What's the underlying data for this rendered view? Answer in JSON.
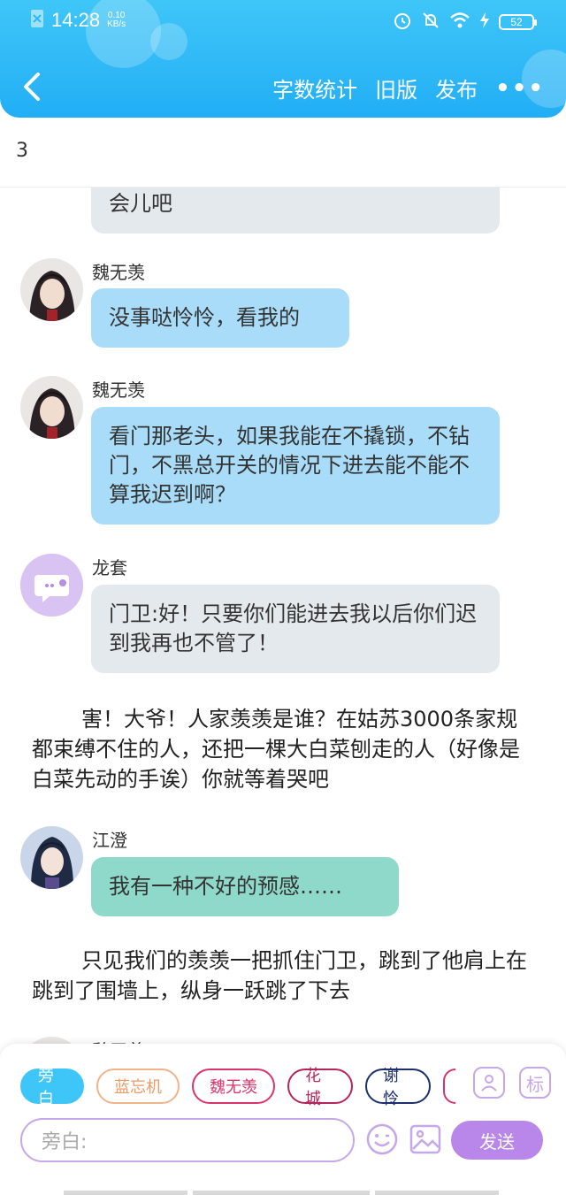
{
  "status_bar": {
    "time": "14:28",
    "net_speed_value": "0.10",
    "net_speed_unit": "KB/s",
    "battery": "52"
  },
  "nav": {
    "word_count": "字数统计",
    "old_version": "旧版",
    "publish": "发布",
    "more": "•••"
  },
  "chapter": "3",
  "messages": {
    "m0": {
      "text": "会儿吧"
    },
    "m1": {
      "name": "魏无羡",
      "text": "没事哒怜怜，看我的"
    },
    "m2": {
      "name": "魏无羡",
      "text": "看门那老头，如果我能在不撬锁，不钻门，不黑总开关的情况下进去能不能不算我迟到啊？"
    },
    "m3": {
      "name": "龙套",
      "text": "门卫:好！只要你们能进去我以后你们迟到我再也不管了！"
    },
    "n1": {
      "text": "害！大爷！人家羡羡是谁？在姑苏3000条家规都束缚不住的人，还把一棵大白菜刨走的人（好像是白菜先动的手诶）你就等着哭吧"
    },
    "m4": {
      "name": "江澄",
      "text": "我有一种不好的预感……"
    },
    "n2": {
      "text": "只见我们的羡羡一把抓住门卫，跳到了他肩上在跳到了围墙上，纵身一跃跳了下去"
    },
    "m5": {
      "name": "魏无羡"
    }
  },
  "roles": {
    "narration": "旁白",
    "lanwangji": "蓝忘机",
    "weiwuxian": "魏无羡",
    "huacheng": "花城",
    "xielian": "谢怜"
  },
  "side_buttons": {
    "tag": "标"
  },
  "composer": {
    "placeholder": "旁白:",
    "send": "发送"
  },
  "colors": {
    "header": "#22aef5",
    "accent_purple": "#b987ea",
    "bubble_grey": "#e4e9ee",
    "bubble_blue": "#a9dcf9",
    "bubble_green": "#8fd9ca"
  }
}
